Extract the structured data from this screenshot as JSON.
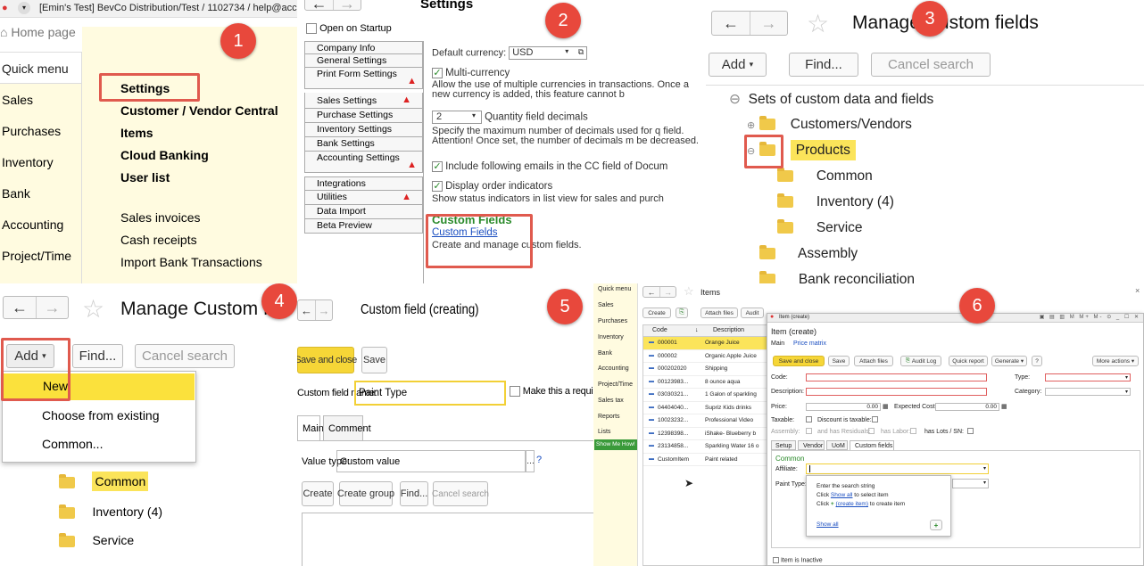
{
  "p1": {
    "tab_title": "[Emin's Test] BevCo Distribution/Test / 1102734 / help@accou",
    "home": "Home page",
    "nav": [
      "Quick menu",
      "Sales",
      "Purchases",
      "Inventory",
      "Bank",
      "Accounting",
      "Project/Time"
    ],
    "menu_bold": [
      "Settings",
      "Customer / Vendor Central",
      "Items",
      "Cloud Banking",
      "User list"
    ],
    "menu_plain": [
      "Sales invoices",
      "Cash receipts",
      "Import Bank Transactions"
    ],
    "badge": "1",
    "bg": "#fffbe0"
  },
  "p2": {
    "open_startup": "Open on Startup",
    "title": "Settings",
    "tabs": [
      "Company Info",
      "General Settings",
      "Print Form Settings",
      "Sales Settings",
      "Purchase Settings",
      "Inventory Settings",
      "Bank Settings",
      "Accounting Settings",
      "Integrations",
      "Utilities",
      "Data Import",
      "Beta Preview"
    ],
    "currency_label": "Default currency:",
    "currency_value": "USD",
    "multi": "Multi-currency",
    "multi_desc": "Allow the use of multiple currencies in transactions. Once a new currency is added, this feature cannot b",
    "qty_value": "2",
    "qty_label": "Quantity field decimals",
    "qty_desc": "Specify the maximum number of decimals used for q field.  Attention!  Once set, the number of decimals m be decreased.",
    "cc": "Include following emails in the CC field of Docum",
    "indicators": "Display order indicators",
    "indicators_desc": "Show status indicators in list view for sales and purch",
    "cf_heading": "Custom Fields",
    "cf_link": "Custom Fields",
    "cf_desc": "Create and manage custom fields.",
    "badge": "2"
  },
  "p3": {
    "title": "Manage Custom fields",
    "add": "Add",
    "find": "Find...",
    "cancel": "Cancel search",
    "tree": [
      "Sets of custom data and fields",
      "Customers/Vendors",
      "Products",
      "Common",
      "Inventory (4)",
      "Service",
      "Assembly",
      "Bank reconciliation"
    ],
    "badge": "3"
  },
  "p4": {
    "title": "Manage Custom fie",
    "add": "Add",
    "find": "Find...",
    "cancel": "Cancel search",
    "menu": [
      "New",
      "Choose from existing",
      "Common..."
    ],
    "tree": [
      "Common",
      "Inventory (4)",
      "Service"
    ],
    "badge": "4"
  },
  "p5": {
    "title": "Custom field (creating)",
    "save_close": "Save and close",
    "save": "Save",
    "name_label": "Custom field name:",
    "name_value": "Paint Type",
    "required": "Make this a required field",
    "tabs": [
      "Main",
      "Comment"
    ],
    "value_type_label": "Value type:",
    "value_type": "Custom value",
    "help": "?",
    "create": "Create",
    "create_group": "Create group",
    "find": "Find...",
    "cancel": "Cancel search",
    "badge": "5"
  },
  "p6": {
    "sidebar": [
      "Quick menu",
      "Sales",
      "Purchases",
      "Inventory",
      "Bank",
      "Accounting",
      "Project/Time",
      "Sales tax",
      "Reports",
      "Lists"
    ],
    "show_me": "Show Me How!",
    "list_title": "Items",
    "list_create": "Create",
    "attach": "Attach files",
    "audit": "Audit",
    "col_code": "Code",
    "col_desc": "Description",
    "rows": [
      [
        "000001",
        "Orange Juice"
      ],
      [
        "000002",
        "Organic Apple Juice"
      ],
      [
        "000202020",
        "Shipping"
      ],
      [
        "00123983...",
        "8 ounce aqua"
      ],
      [
        "03030321...",
        "1 Galon of sparkling"
      ],
      [
        "04404040...",
        "Supriz Kids drinks"
      ],
      [
        "10023232...",
        "Professional Video"
      ],
      [
        "12398398...",
        "iShake- Blueberry b"
      ],
      [
        "23134858...",
        "Sparkling Water 16 o"
      ],
      [
        "CustomItem",
        "Paint related"
      ]
    ],
    "dlg_titlebar": "Item (create)",
    "dlg_title": "Item (create)",
    "dlg_tabs": [
      "Main",
      "Price matrix"
    ],
    "dlg_btns": [
      "Save and close",
      "Save",
      "Attach files",
      "Audit Log",
      "Quick report",
      "Generate",
      "?"
    ],
    "more": "More actions",
    "code": "Code:",
    "type": "Type:",
    "desc": "Description:",
    "category": "Category:",
    "price": "Price:",
    "price_val": "0.00",
    "exp_cost": "Expected Cost:",
    "exp_val": "0.00",
    "taxable": "Taxable:",
    "discount": "Discount is taxable:",
    "assembly": "Assembly:",
    "residuals": "and has Residuals:",
    "labor": "has Labor:",
    "lots": "has Lots / SN:",
    "subtabs": [
      "Setup",
      "Vendor",
      "UoM",
      "Custom fields"
    ],
    "section": "Common",
    "affiliate": "Affiliate:",
    "paint": "Paint Type:",
    "pop1": "Enter the search string",
    "pop2a": "Click ",
    "pop2b": "Show all",
    "pop2c": " to select item",
    "pop3a": "Click ",
    "pop3b": "(create item)",
    "pop3c": " to create item",
    "showall": "Show all",
    "inactive": "Item is Inactive",
    "close_x": "×",
    "badge": "6"
  }
}
